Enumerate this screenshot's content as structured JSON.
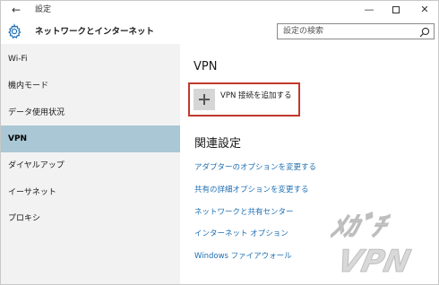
{
  "window": {
    "back_glyph": "←",
    "title": "設定",
    "minimize_glyph": "—",
    "close_glyph": "✕"
  },
  "header": {
    "title": "ネットワークとインターネット",
    "search_placeholder": "設定の検索"
  },
  "sidebar": {
    "items": [
      {
        "label": "Wi-Fi"
      },
      {
        "label": "機内モード"
      },
      {
        "label": "データ使用状況"
      },
      {
        "label": "VPN",
        "selected": true
      },
      {
        "label": "ダイヤルアップ"
      },
      {
        "label": "イーサネット"
      },
      {
        "label": "プロキシ"
      }
    ]
  },
  "main": {
    "title": "VPN",
    "add_button_label": "VPN 接続を追加する",
    "related_title": "関連設定",
    "links": [
      {
        "label": "アダプターのオプションを変更する"
      },
      {
        "label": "共有の詳細オプションを変更する"
      },
      {
        "label": "ネットワークと共有センター"
      },
      {
        "label": "インターネット オプション"
      },
      {
        "label": "Windows ファイアウォール"
      }
    ]
  },
  "colors": {
    "accent_link": "#1f6fb3",
    "selected_bg": "#a9c7d4",
    "highlight_border": "#c0392b",
    "sidebar_bg": "#f2f2f2"
  },
  "watermark": {
    "line1": "ﾒｶﾞﾁ",
    "line2": "VPN"
  }
}
